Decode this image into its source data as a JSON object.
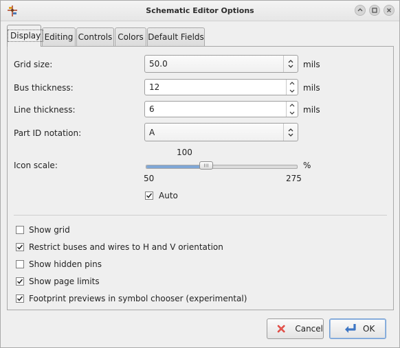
{
  "window": {
    "title": "Schematic Editor Options",
    "icons": [
      "schematic-app-icon",
      "shade-icon",
      "maximize-icon",
      "close-icon"
    ]
  },
  "tabs": [
    {
      "label": "Display",
      "active": true
    },
    {
      "label": "Editing",
      "active": false
    },
    {
      "label": "Controls",
      "active": false
    },
    {
      "label": "Colors",
      "active": false
    },
    {
      "label": "Default Fields",
      "active": false
    }
  ],
  "display": {
    "grid_size": {
      "label": "Grid size:",
      "value": "50.0",
      "unit": "mils"
    },
    "bus_thickness": {
      "label": "Bus thickness:",
      "value": "12",
      "unit": "mils"
    },
    "line_thickness": {
      "label": "Line thickness:",
      "value": "6",
      "unit": "mils"
    },
    "part_id_notation": {
      "label": "Part ID notation:",
      "value": "A"
    },
    "icon_scale": {
      "label": "Icon scale:",
      "value": "100",
      "value_num": 100,
      "min": "50",
      "max": "275",
      "min_num": 50,
      "max_num": 275,
      "unit": "%"
    },
    "auto": {
      "label": "Auto",
      "checked": true
    }
  },
  "options": [
    {
      "label": "Show grid",
      "checked": false
    },
    {
      "label": "Restrict buses and wires to H and V orientation",
      "checked": true
    },
    {
      "label": "Show hidden pins",
      "checked": false
    },
    {
      "label": "Show page limits",
      "checked": true
    },
    {
      "label": "Footprint previews in symbol chooser (experimental)",
      "checked": true
    }
  ],
  "buttons": {
    "cancel": "Cancel",
    "ok": "OK"
  },
  "colors": {
    "slider_fill": "#7fa7d6",
    "cancel_icon": "#d9302a",
    "ok_icon": "#3d76c4"
  }
}
